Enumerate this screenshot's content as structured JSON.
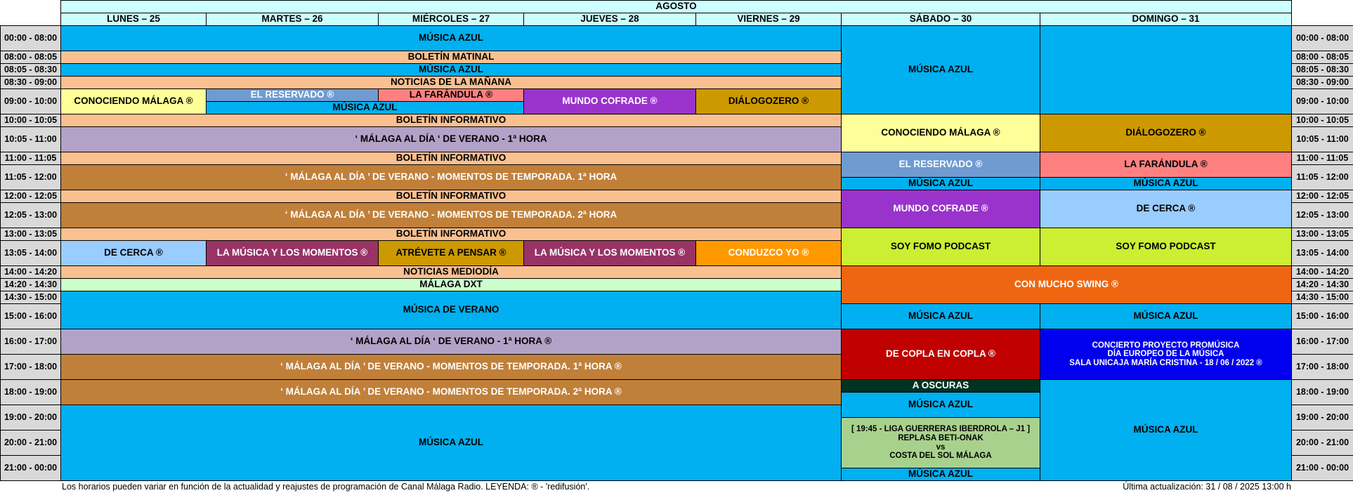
{
  "header": {
    "month": "AGOSTO",
    "days": [
      "LUNES – 25",
      "MARTES – 26",
      "MIÉRCOLES – 27",
      "JUEVES – 28",
      "VIERNES – 29",
      "SÁBADO – 30",
      "DOMINGO – 31"
    ]
  },
  "time_slots": [
    "00:00 - 08:00",
    "08:00 - 08:05",
    "08:05 - 08:30",
    "08:30 - 09:00",
    "09:00 - 10:00",
    "10:00 - 10:05",
    "10:05 - 11:00",
    "11:00 - 11:05",
    "11:05 - 12:00",
    "12:00 - 12:05",
    "12:05 - 13:00",
    "13:00 - 13:05",
    "13:05 - 14:00",
    "14:00 - 14:20",
    "14:20 - 14:30",
    "14:30 - 15:00",
    "15:00 - 16:00",
    "16:00 - 17:00",
    "17:00 - 18:00",
    "18:00 - 19:00",
    "19:00 - 20:00",
    "20:00 - 21:00",
    "21:00 - 00:00"
  ],
  "programs": [
    {
      "day": 0,
      "span": 5,
      "row": 0,
      "rows": 1,
      "lines": [
        "MÚSICA  AZUL"
      ],
      "bg": "#00b0f0",
      "fg": "#000000"
    },
    {
      "day": 0,
      "span": 5,
      "row": 1,
      "rows": 1,
      "lines": [
        "BOLETÍN  MATINAL"
      ],
      "bg": "#fac090",
      "fg": "#000000"
    },
    {
      "day": 0,
      "span": 5,
      "row": 2,
      "rows": 1,
      "lines": [
        "MÚSICA  AZUL"
      ],
      "bg": "#00b0f0",
      "fg": "#000000"
    },
    {
      "day": 0,
      "span": 5,
      "row": 3,
      "rows": 1,
      "lines": [
        "NOTICIAS  DE  LA  MAÑANA"
      ],
      "bg": "#fac090",
      "fg": "#000000"
    },
    {
      "day": 0,
      "span": 1,
      "row": 4,
      "rows": 1,
      "lines": [
        "CONOCIENDO  MÁLAGA    ®"
      ],
      "bg": "#ffff99",
      "fg": "#000000"
    },
    {
      "day": 1,
      "span": 1,
      "row": 4,
      "rows": 0.5,
      "lines": [
        "EL  RESERVADO    ®"
      ],
      "bg": "#6f9bd1",
      "fg": "#ffffff"
    },
    {
      "day": 2,
      "span": 1,
      "row": 4,
      "rows": 0.5,
      "lines": [
        "LA  FARÁNDULA    ®"
      ],
      "bg": "#ff8080",
      "fg": "#000000"
    },
    {
      "day": 1,
      "span": 2,
      "row": 4.5,
      "rows": 0.5,
      "lines": [
        "MÚSICA  AZUL"
      ],
      "bg": "#00b0f0",
      "fg": "#000000"
    },
    {
      "day": 3,
      "span": 1,
      "row": 4,
      "rows": 1,
      "lines": [
        "MUNDO  COFRADE    ®"
      ],
      "bg": "#9933cc",
      "fg": "#ffffff"
    },
    {
      "day": 4,
      "span": 1,
      "row": 4,
      "rows": 1,
      "lines": [
        "DIÁLOGOZERO    ®"
      ],
      "bg": "#cc9900",
      "fg": "#000000"
    },
    {
      "day": 0,
      "span": 5,
      "row": 5,
      "rows": 1,
      "lines": [
        "BOLETÍN  INFORMATIVO"
      ],
      "bg": "#fac090",
      "fg": "#000000"
    },
    {
      "day": 0,
      "span": 5,
      "row": 6,
      "rows": 1,
      "lines": [
        "‘ MÁLAGA  AL  DÍA ‘  DE  VERANO  -  1ª  HORA"
      ],
      "bg": "#b3a2c7",
      "fg": "#000000"
    },
    {
      "day": 0,
      "span": 5,
      "row": 7,
      "rows": 1,
      "lines": [
        "BOLETÍN  INFORMATIVO"
      ],
      "bg": "#fac090",
      "fg": "#000000"
    },
    {
      "day": 0,
      "span": 5,
      "row": 8,
      "rows": 1,
      "lines": [
        "‘ MÁLAGA  AL  DÍA ’  DE  VERANO  -  MOMENTOS  DE  TEMPORADA.  1ª  HORA"
      ],
      "bg": "#c0803a",
      "fg": "#ffffff"
    },
    {
      "day": 0,
      "span": 5,
      "row": 9,
      "rows": 1,
      "lines": [
        "BOLETÍN  INFORMATIVO"
      ],
      "bg": "#fac090",
      "fg": "#000000"
    },
    {
      "day": 0,
      "span": 5,
      "row": 10,
      "rows": 1,
      "lines": [
        "‘ MÁLAGA  AL  DÍA ’  DE  VERANO  -  MOMENTOS  DE  TEMPORADA.  2ª  HORA"
      ],
      "bg": "#c0803a",
      "fg": "#ffffff"
    },
    {
      "day": 0,
      "span": 5,
      "row": 11,
      "rows": 1,
      "lines": [
        "BOLETÍN  INFORMATIVO"
      ],
      "bg": "#fac090",
      "fg": "#000000"
    },
    {
      "day": 0,
      "span": 1,
      "row": 12,
      "rows": 1,
      "lines": [
        "DE  CERCA    ®"
      ],
      "bg": "#99ccff",
      "fg": "#000000"
    },
    {
      "day": 1,
      "span": 1,
      "row": 12,
      "rows": 1,
      "lines": [
        "LA  MÚSICA Y  LOS  MOMENTOS   ®"
      ],
      "bg": "#993366",
      "fg": "#ffffff"
    },
    {
      "day": 2,
      "span": 1,
      "row": 12,
      "rows": 1,
      "lines": [
        "ATRÉVETE  A  PENSAR    ®"
      ],
      "bg": "#cc9900",
      "fg": "#000000"
    },
    {
      "day": 3,
      "span": 1,
      "row": 12,
      "rows": 1,
      "lines": [
        "LA  MÚSICA Y  LOS  MOMENTOS   ®"
      ],
      "bg": "#993366",
      "fg": "#ffffff"
    },
    {
      "day": 4,
      "span": 1,
      "row": 12,
      "rows": 1,
      "lines": [
        "CONDUZCO  YO    ®"
      ],
      "bg": "#ff9900",
      "fg": "#ffffff"
    },
    {
      "day": 0,
      "span": 5,
      "row": 13,
      "rows": 1,
      "lines": [
        "NOTICIAS  MEDIODÍA"
      ],
      "bg": "#fac090",
      "fg": "#000000"
    },
    {
      "day": 0,
      "span": 5,
      "row": 14,
      "rows": 1,
      "lines": [
        "MÁLAGA  DXT"
      ],
      "bg": "#ccffcc",
      "fg": "#000000"
    },
    {
      "day": 0,
      "span": 5,
      "row": 15,
      "rows": 2,
      "lines": [
        "MÚSICA   DE  VERANO"
      ],
      "bg": "#00b0f0",
      "fg": "#000000"
    },
    {
      "day": 0,
      "span": 5,
      "row": 17,
      "rows": 1,
      "lines": [
        "‘ MÁLAGA  AL  DÍA ‘  DE  VERANO  -  1ª  HORA    ®"
      ],
      "bg": "#b3a2c7",
      "fg": "#000000"
    },
    {
      "day": 0,
      "span": 5,
      "row": 18,
      "rows": 1,
      "lines": [
        "‘ MÁLAGA  AL  DÍA ’  DE  VERANO  -  MOMENTOS  DE  TEMPORADA.  1ª  HORA    ®"
      ],
      "bg": "#c0803a",
      "fg": "#ffffff"
    },
    {
      "day": 0,
      "span": 5,
      "row": 19,
      "rows": 1,
      "lines": [
        "‘ MÁLAGA  AL  DÍA ’  DE  VERANO  -  MOMENTOS  DE  TEMPORADA.  2ª  HORA    ®"
      ],
      "bg": "#c0803a",
      "fg": "#ffffff"
    },
    {
      "day": 0,
      "span": 5,
      "row": 20,
      "rows": 3,
      "lines": [
        "MÚSICA  AZUL"
      ],
      "bg": "#00b0f0",
      "fg": "#000000"
    },
    {
      "day": 5,
      "span": 1,
      "row": 0,
      "rows": 5,
      "lines": [
        "MÚSICA  AZUL"
      ],
      "bg": "#00b0f0",
      "fg": "#000000"
    },
    {
      "day": 6,
      "span": 1,
      "row": 0,
      "rows": 5,
      "lines": [],
      "bg": "#00b0f0",
      "fg": "#000000"
    },
    {
      "day": 5,
      "span": 1,
      "row": 5,
      "rows": 2,
      "lines": [
        "CONOCIENDO  MÁLAGA    ®"
      ],
      "bg": "#ffff99",
      "fg": "#000000"
    },
    {
      "day": 6,
      "span": 1,
      "row": 5,
      "rows": 2,
      "lines": [
        "DIÁLOGOZERO    ®"
      ],
      "bg": "#cc9900",
      "fg": "#000000"
    },
    {
      "day": 5,
      "span": 1,
      "row": 7,
      "rows": 1.5,
      "lines": [
        "EL  RESERVADO    ®"
      ],
      "bg": "#6f9bd1",
      "fg": "#ffffff"
    },
    {
      "day": 6,
      "span": 1,
      "row": 7,
      "rows": 1.5,
      "lines": [
        "LA  FARÁNDULA    ®"
      ],
      "bg": "#ff8080",
      "fg": "#000000"
    },
    {
      "day": 5,
      "span": 1,
      "row": 8.5,
      "rows": 0.5,
      "lines": [
        "MÚSICA  AZUL"
      ],
      "bg": "#00b0f0",
      "fg": "#000000"
    },
    {
      "day": 6,
      "span": 1,
      "row": 8.5,
      "rows": 0.5,
      "lines": [
        "MÚSICA  AZUL"
      ],
      "bg": "#00b0f0",
      "fg": "#000000"
    },
    {
      "day": 5,
      "span": 1,
      "row": 9,
      "rows": 2,
      "lines": [
        "MUNDO  COFRADE    ®"
      ],
      "bg": "#9933cc",
      "fg": "#ffffff"
    },
    {
      "day": 6,
      "span": 1,
      "row": 9,
      "rows": 2,
      "lines": [
        "DE  CERCA    ®"
      ],
      "bg": "#99ccff",
      "fg": "#000000"
    },
    {
      "day": 5,
      "span": 1,
      "row": 11,
      "rows": 2,
      "lines": [
        "SOY  FOMO  PODCAST"
      ],
      "bg": "#ccee33",
      "fg": "#000000"
    },
    {
      "day": 6,
      "span": 1,
      "row": 11,
      "rows": 2,
      "lines": [
        "SOY  FOMO  PODCAST"
      ],
      "bg": "#ccee33",
      "fg": "#000000"
    },
    {
      "day": 5,
      "span": 2,
      "row": 13,
      "rows": 3,
      "lines": [
        "CON  MUCHO  SWING    ®"
      ],
      "bg": "#ee6611",
      "fg": "#ffffff"
    },
    {
      "day": 5,
      "span": 1,
      "row": 16,
      "rows": 1,
      "lines": [
        "MÚSICA  AZUL"
      ],
      "bg": "#00b0f0",
      "fg": "#000000"
    },
    {
      "day": 6,
      "span": 1,
      "row": 16,
      "rows": 1,
      "lines": [
        "MÚSICA  AZUL"
      ],
      "bg": "#00b0f0",
      "fg": "#000000"
    },
    {
      "day": 5,
      "span": 1,
      "row": 17,
      "rows": 2,
      "lines": [
        "DE  COPLA  EN  COPLA    ®"
      ],
      "bg": "#c00000",
      "fg": "#ffffff"
    },
    {
      "day": 6,
      "span": 1,
      "row": 17,
      "rows": 2,
      "lines": [
        "CONCIERTO  PROYECTO  PROMÚSICA",
        "DÍA  EUROPEO  DE  LA  MÚSICA",
        "SALA  UNICAJA  MARÍA  CRISTINA  -  18 / 06 / 2022   ®"
      ],
      "bg": "#0000ee",
      "fg": "#ffffff"
    },
    {
      "day": 5,
      "span": 1,
      "row": 19,
      "rows": 0.5,
      "lines": [
        "A  OSCURAS"
      ],
      "bg": "#003322",
      "fg": "#ffffff"
    },
    {
      "day": 5,
      "span": 1,
      "row": 19.5,
      "rows": 1,
      "lines": [
        "MÚSICA  AZUL"
      ],
      "bg": "#00b0f0",
      "fg": "#000000"
    },
    {
      "day": 5,
      "span": 1,
      "row": 20.5,
      "rows": 2,
      "lines": [
        "[ 19:45 - LIGA  GUERRERAS  IBERDROLA – J1 ]",
        "REPLASA  BETI-ONAK",
        "vs",
        "COSTA  DEL  SOL  MÁLAGA"
      ],
      "bg": "#a9d18e",
      "fg": "#000000"
    },
    {
      "day": 5,
      "span": 1,
      "row": 22.5,
      "rows": 0.5,
      "lines": [
        "MÚSICA  AZUL"
      ],
      "bg": "#00b0f0",
      "fg": "#000000"
    },
    {
      "day": 6,
      "span": 1,
      "row": 19,
      "rows": 4,
      "lines": [
        "MÚSICA  AZUL"
      ],
      "bg": "#00b0f0",
      "fg": "#000000"
    }
  ],
  "footer": {
    "note": "Los horarios pueden variar en función de la actualidad y reajustes de programación de Canal Málaga Radio.  LEYENDA: ® - 'redifusión'.",
    "updated": "Última actualización:  31 / 08 / 2025    13:00 h"
  }
}
